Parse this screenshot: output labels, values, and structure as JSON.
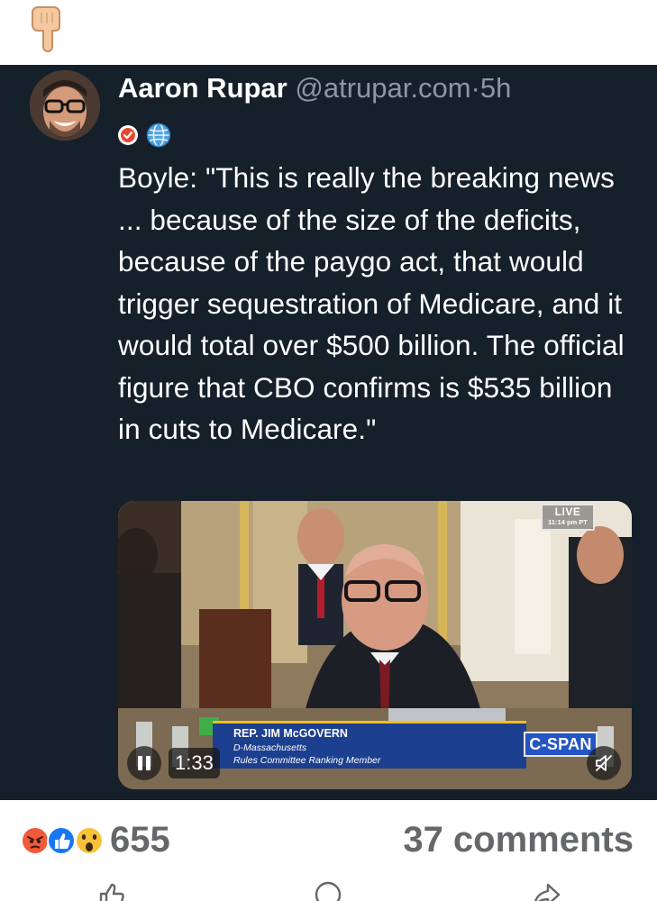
{
  "top_emoji": {
    "icon": "backhand-index-pointing-down-icon"
  },
  "post": {
    "author_name": "Aaron Rupar",
    "handle": "@atrupar.com",
    "separator": "·",
    "time_ago": "5h",
    "badges": [
      "verified-check-icon",
      "globe-icon"
    ],
    "text": "Boyle: \"This is really the breaking news ... because of the size of the deficits, because of the paygo act, that would trigger sequestration of Medicare, and it would total over $500 billion. The official figure that CBO confirms is $535 billion in cuts to Medicare.\""
  },
  "video": {
    "live_label": "LIVE",
    "live_time": "11:14 pm PT",
    "chyron_name": "REP. JIM McGOVERN",
    "chyron_party": "D-Massachusetts",
    "chyron_role": "Rules Committee Ranking Member",
    "network_logo": "C-SPAN",
    "duration": "1:33",
    "state": "playing"
  },
  "footer": {
    "reactions": [
      "angry-reaction-icon",
      "like-reaction-icon",
      "wow-reaction-icon"
    ],
    "reaction_count": "655",
    "comments_label": "37 comments",
    "actions": [
      "like-icon",
      "comment-icon",
      "share-icon"
    ]
  },
  "colors": {
    "card_background": "#15202b",
    "muted_text": "#8b98a5",
    "count_text": "#65676b",
    "cspan_blue": "#2455c3"
  }
}
